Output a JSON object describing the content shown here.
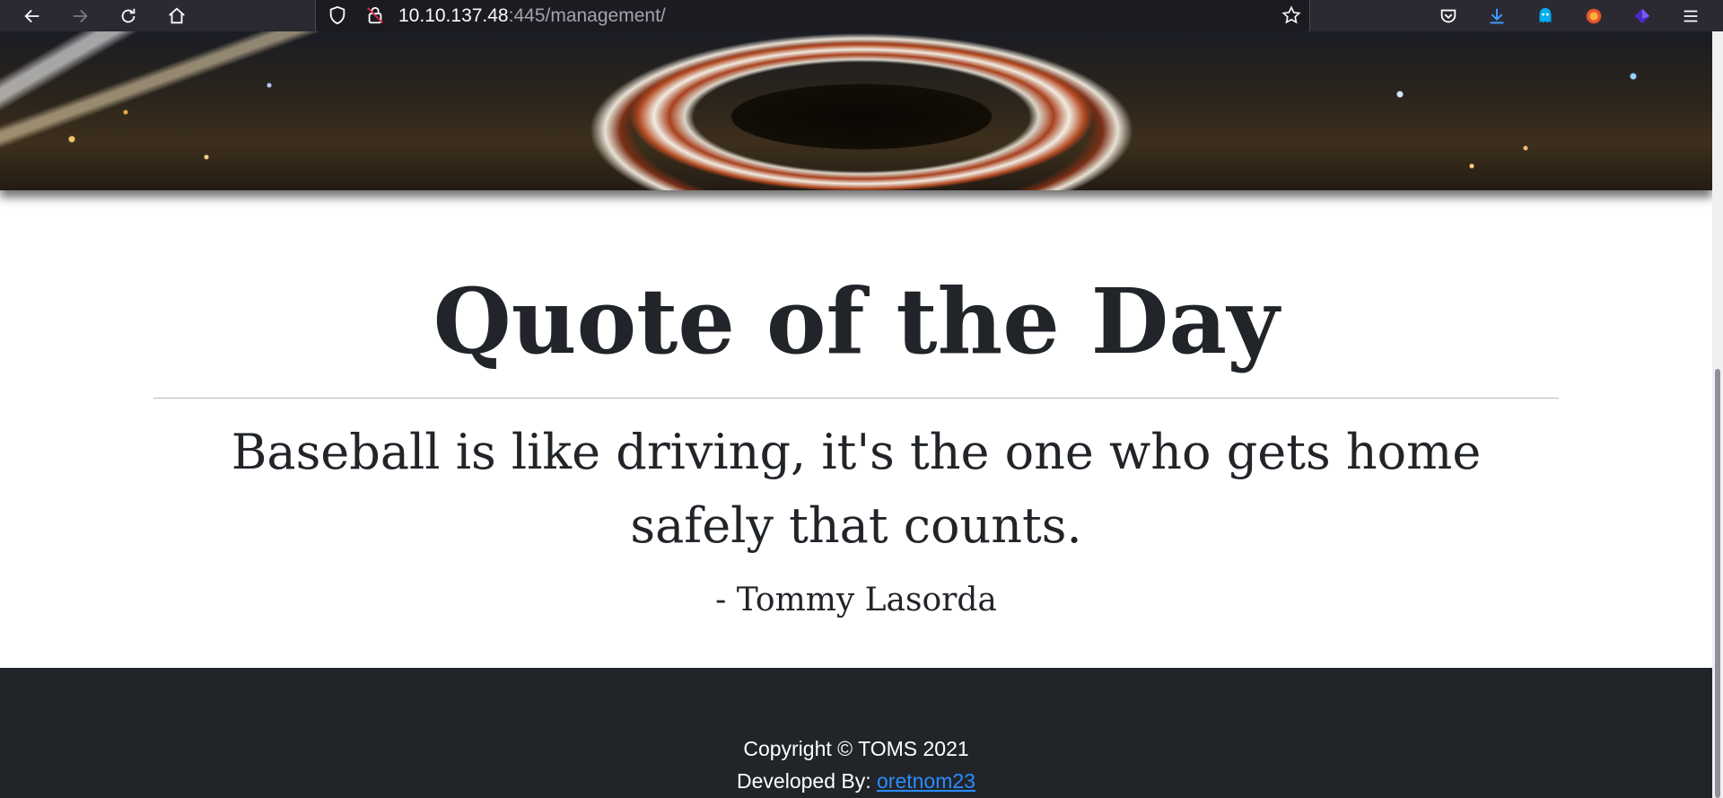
{
  "browser": {
    "url_host": "10.10.137.48",
    "url_rest": ":445/management/",
    "icons": [
      "back-icon",
      "forward-icon",
      "reload-icon",
      "home-icon",
      "shield-icon",
      "insecure-lock-icon",
      "bookmark-star-icon",
      "pocket-icon",
      "download-icon",
      "ghostery-icon",
      "extension-icon",
      "extension-purple-icon",
      "menu-icon"
    ]
  },
  "main": {
    "title": "Quote of the Day",
    "quote": "Baseball is like driving, it's the one who gets home safely that counts.",
    "author": "- Tommy Lasorda"
  },
  "footer": {
    "copyright": "Copyright © TOMS 2021",
    "developed_by": "Developed By:",
    "developer_link": "oretnom23"
  },
  "colors": {
    "toolbar_bg": "#2b2a33",
    "footer_bg": "#212529",
    "text": "#212529",
    "link": "#2a8cff"
  }
}
